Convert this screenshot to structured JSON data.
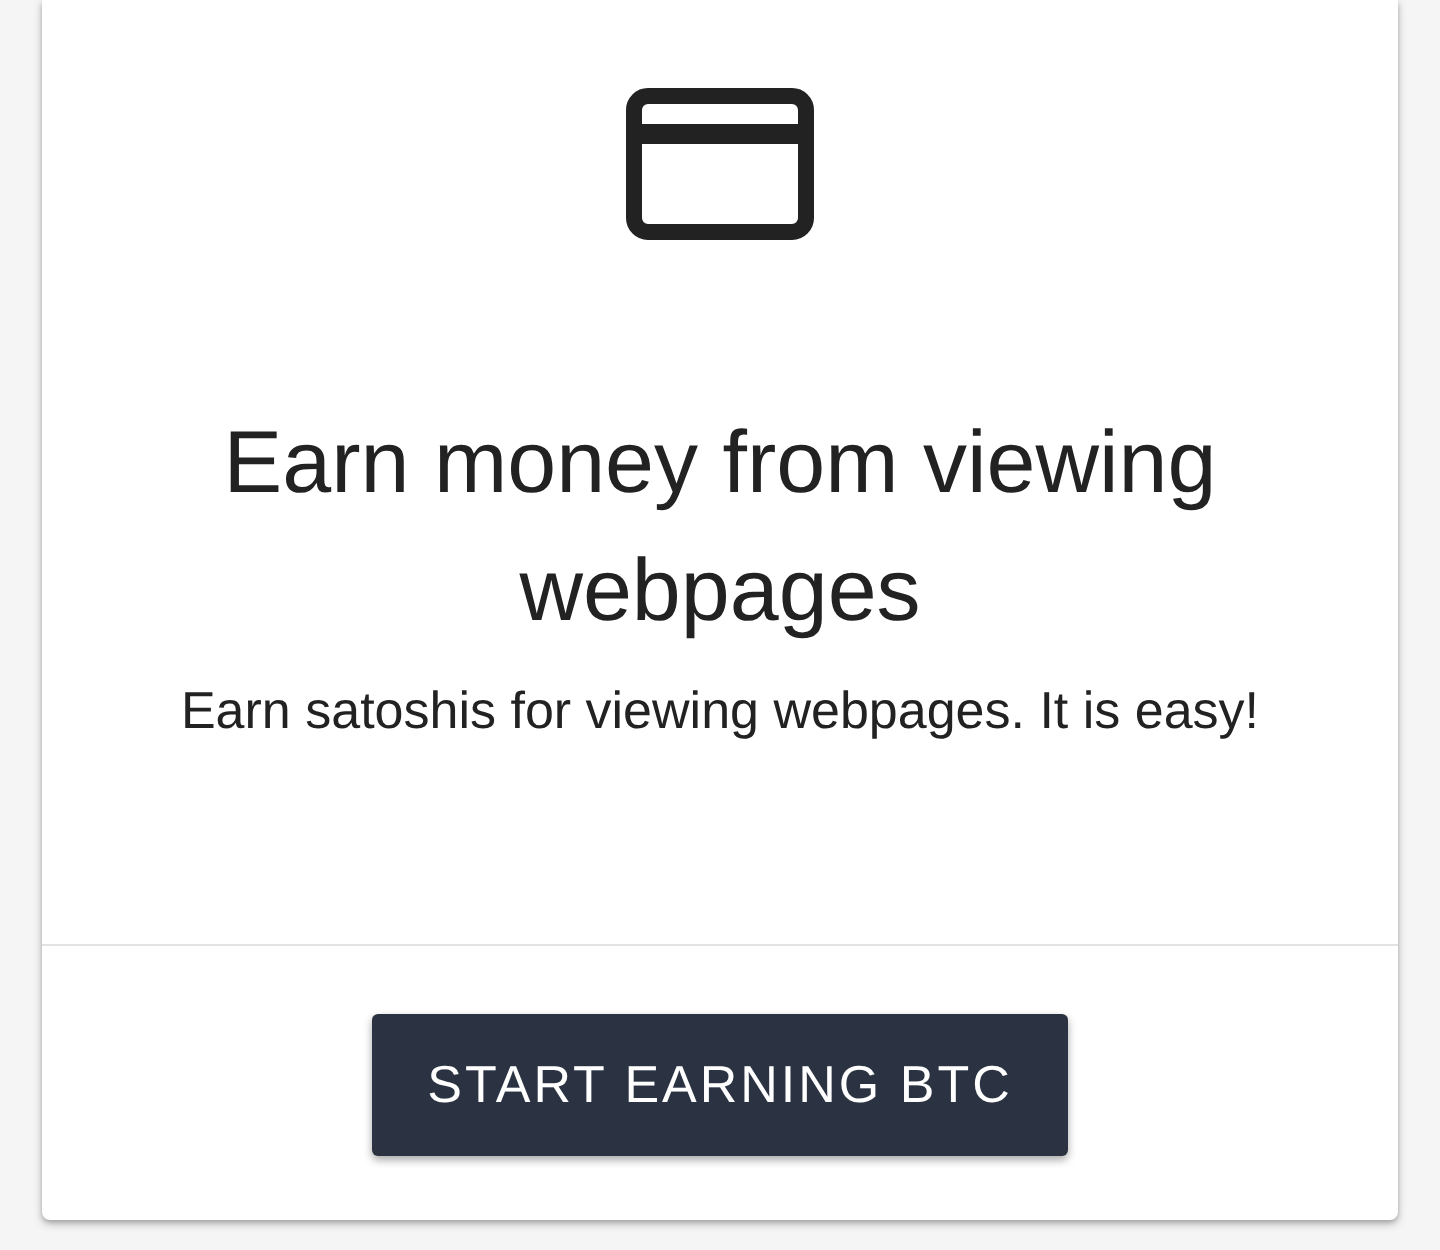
{
  "card": {
    "title": "Earn money from viewing webpages",
    "subtitle": "Earn satoshis for viewing webpages. It is easy!",
    "button": "START EARNING BTC"
  }
}
